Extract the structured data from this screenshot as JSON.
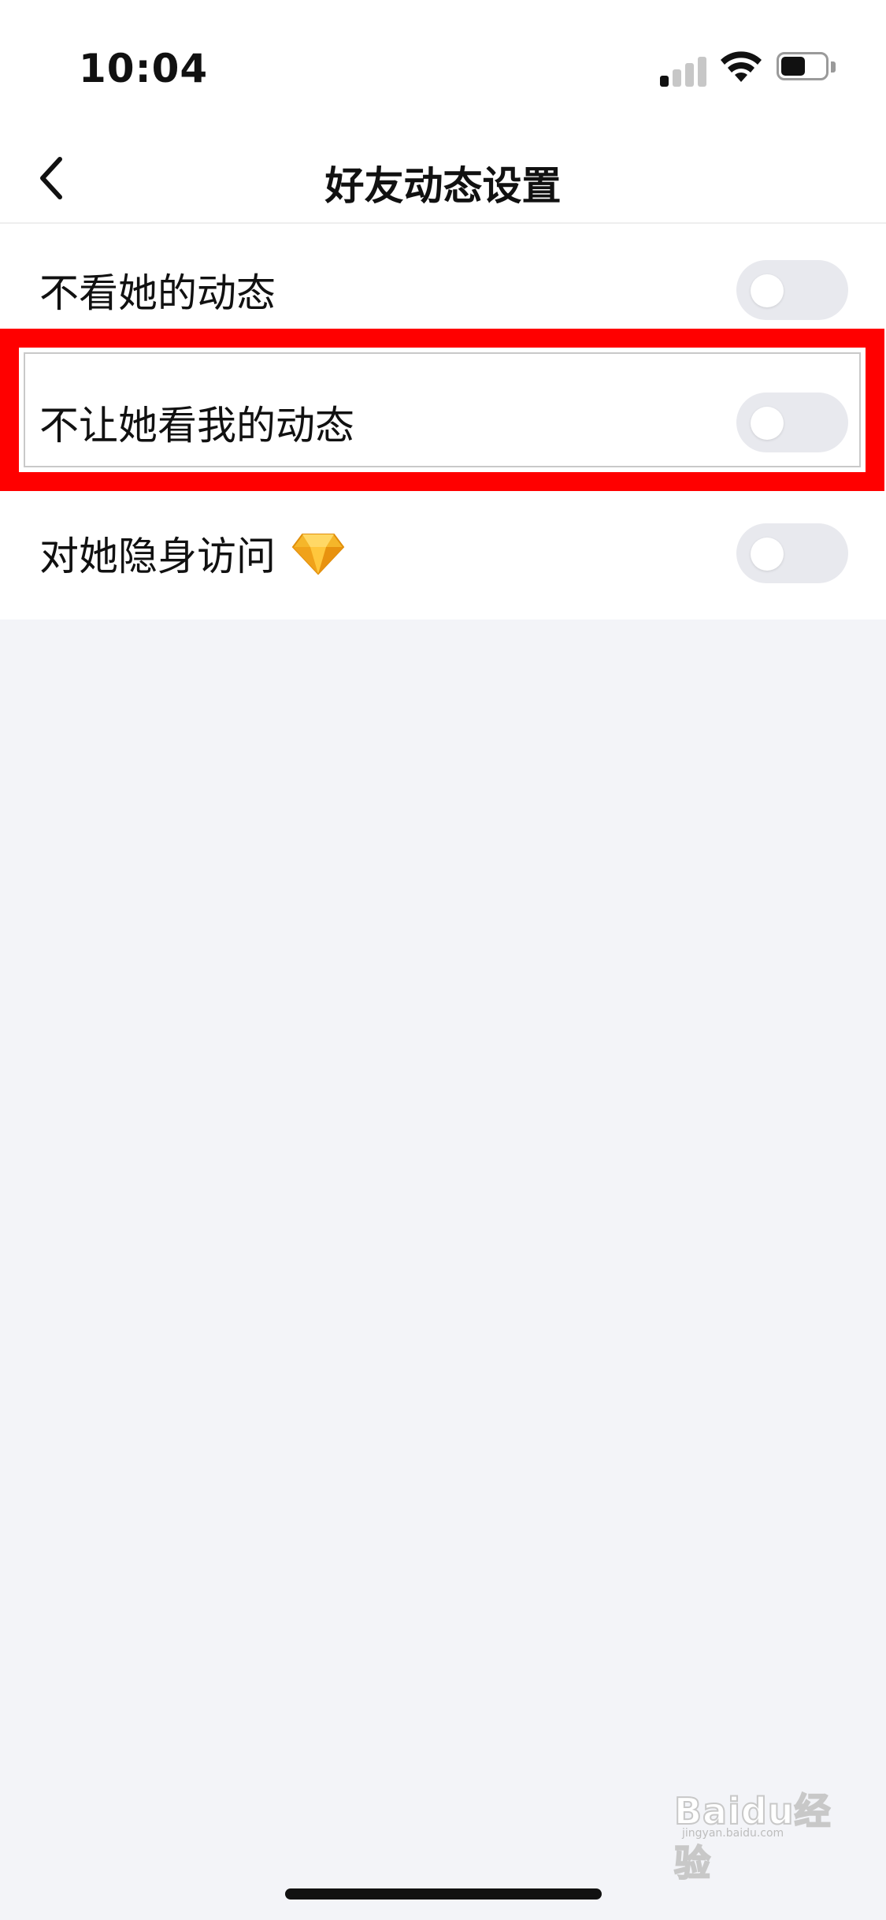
{
  "status_bar": {
    "time": "10:04",
    "signal_icon": "cellular-signal-icon",
    "wifi_icon": "wifi-icon",
    "battery_icon": "battery-icon",
    "battery_level": 0.55
  },
  "nav": {
    "title": "好友动态设置",
    "back_icon": "chevron-left-icon"
  },
  "settings": [
    {
      "label": "不看她的动态",
      "enabled": false
    },
    {
      "label": "不让她看我的动态",
      "enabled": false,
      "highlighted": true
    },
    {
      "label": "对她隐身访问",
      "enabled": false,
      "badge_icon": "diamond-icon"
    }
  ],
  "watermark": {
    "text": "Baidu经验",
    "sub": "jingyan.baidu.com"
  },
  "colors": {
    "highlight": "#ff0000",
    "toggle_off": "#e8e9ee",
    "background": "#f3f4f8"
  }
}
